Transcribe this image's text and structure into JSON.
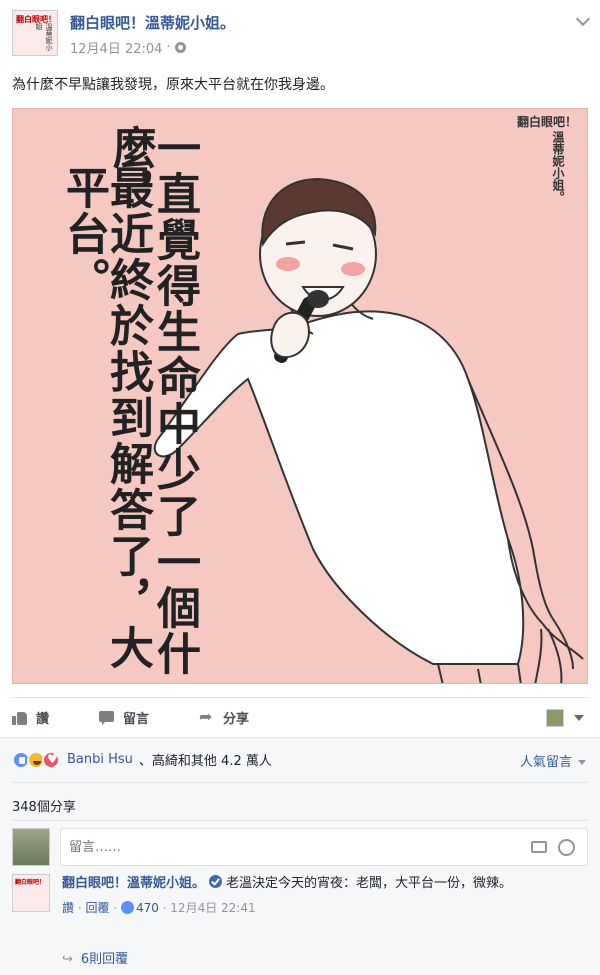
{
  "post": {
    "page_name": "翻白眼吧！溫蒂妮小姐。",
    "avatar_text_top": "翻白眼吧！",
    "avatar_text_side": "溫蒂妮小姐",
    "timestamp": "12月4日 22:04",
    "caption": "為什麼不早點讓我發現，原來大平台就在你我身邊。"
  },
  "image": {
    "text_col1": "一直覺得生命中少了一個什麼，",
    "text_col2": "最近終於找到解答了，大平台。",
    "brand_top": "翻白眼吧！",
    "brand_side": "溫蒂妮小姐。",
    "colors": {
      "background": "#f5c9c2"
    }
  },
  "actions": {
    "like": "讚",
    "comment": "留言",
    "share": "分享"
  },
  "reactions": {
    "names": "Banbi Hsu",
    "others": "、高綺和其他 4.2 萬人",
    "top_comments": "人氣留言"
  },
  "shares": {
    "text": "348個分享"
  },
  "compose": {
    "placeholder": "留言……"
  },
  "comment": {
    "author": "翻白眼吧！溫蒂妮小姐。",
    "text": "老溫決定今天的宵夜：老闆，大平台一份，微辣。",
    "like": "讚",
    "reply": "回覆",
    "likes": "470",
    "time": "12月4日 22:41"
  },
  "replies": {
    "text": "6則回覆"
  }
}
